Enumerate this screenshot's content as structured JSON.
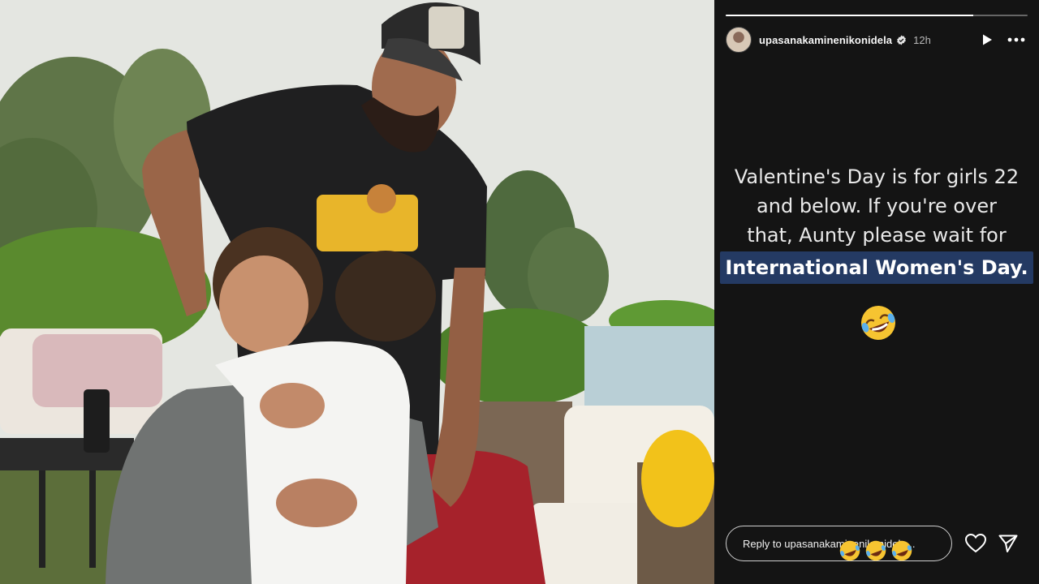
{
  "story": {
    "username": "upasanakaminenikonidela",
    "verified": true,
    "time_ago": "12h",
    "progress_fraction": 0.82,
    "caption_lines": [
      "Valentine's Day is for girls 22",
      "and below. If you're over",
      "that, Aunty please wait for"
    ],
    "caption_highlight": "International Women's Day.",
    "caption_emoji": "rolling-on-the-floor-laughing",
    "reply_placeholder": "Reply to upasanakaminenikonidela...",
    "reply_emojis": [
      "rolling-on-the-floor-laughing",
      "rolling-on-the-floor-laughing",
      "rolling-on-the-floor-laughing"
    ],
    "icons": {
      "play": "play-icon",
      "more": "more-icon",
      "like": "heart-icon",
      "share": "send-icon"
    }
  },
  "photo": {
    "description_icon": "photo"
  },
  "colors": {
    "panel_bg": "#141414",
    "highlight_bg": "#243a63",
    "text": "#e9e9e9"
  }
}
